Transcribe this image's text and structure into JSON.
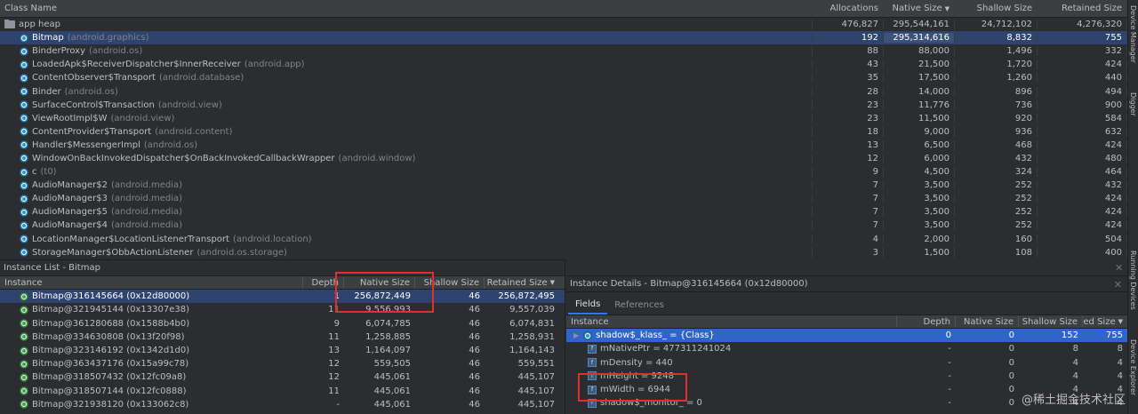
{
  "class_table": {
    "headers": {
      "name": "Class Name",
      "alloc": "Allocations",
      "native": "Native Size",
      "shallow": "Shallow Size",
      "retained": "Retained Size"
    },
    "sort_arrow": "▼",
    "heap_row": {
      "name": "app heap",
      "alloc": "476,827",
      "native": "295,544,161",
      "shallow": "24,712,102",
      "retained": "4,276,320"
    },
    "rows": [
      {
        "name": "Bitmap",
        "pkg": "(android.graphics)",
        "alloc": "192",
        "native": "295,314,616",
        "shallow": "8,832",
        "retained": "755"
      },
      {
        "name": "BinderProxy",
        "pkg": "(android.os)",
        "alloc": "88",
        "native": "88,000",
        "shallow": "1,496",
        "retained": "332"
      },
      {
        "name": "LoadedApk$ReceiverDispatcher$InnerReceiver",
        "pkg": "(android.app)",
        "alloc": "43",
        "native": "21,500",
        "shallow": "1,720",
        "retained": "424"
      },
      {
        "name": "ContentObserver$Transport",
        "pkg": "(android.database)",
        "alloc": "35",
        "native": "17,500",
        "shallow": "1,260",
        "retained": "440"
      },
      {
        "name": "Binder",
        "pkg": "(android.os)",
        "alloc": "28",
        "native": "14,000",
        "shallow": "896",
        "retained": "494"
      },
      {
        "name": "SurfaceControl$Transaction",
        "pkg": "(android.view)",
        "alloc": "23",
        "native": "11,776",
        "shallow": "736",
        "retained": "900"
      },
      {
        "name": "ViewRootImpl$W",
        "pkg": "(android.view)",
        "alloc": "23",
        "native": "11,500",
        "shallow": "920",
        "retained": "584"
      },
      {
        "name": "ContentProvider$Transport",
        "pkg": "(android.content)",
        "alloc": "18",
        "native": "9,000",
        "shallow": "936",
        "retained": "632"
      },
      {
        "name": "Handler$MessengerImpl",
        "pkg": "(android.os)",
        "alloc": "13",
        "native": "6,500",
        "shallow": "468",
        "retained": "424"
      },
      {
        "name": "WindowOnBackInvokedDispatcher$OnBackInvokedCallbackWrapper",
        "pkg": "(android.window)",
        "alloc": "12",
        "native": "6,000",
        "shallow": "432",
        "retained": "480"
      },
      {
        "name": "c",
        "pkg": "(t0)",
        "alloc": "9",
        "native": "4,500",
        "shallow": "324",
        "retained": "464"
      },
      {
        "name": "AudioManager$2",
        "pkg": "(android.media)",
        "alloc": "7",
        "native": "3,500",
        "shallow": "252",
        "retained": "432"
      },
      {
        "name": "AudioManager$3",
        "pkg": "(android.media)",
        "alloc": "7",
        "native": "3,500",
        "shallow": "252",
        "retained": "424"
      },
      {
        "name": "AudioManager$5",
        "pkg": "(android.media)",
        "alloc": "7",
        "native": "3,500",
        "shallow": "252",
        "retained": "424"
      },
      {
        "name": "AudioManager$4",
        "pkg": "(android.media)",
        "alloc": "7",
        "native": "3,500",
        "shallow": "252",
        "retained": "424"
      },
      {
        "name": "LocationManager$LocationListenerTransport",
        "pkg": "(android.location)",
        "alloc": "4",
        "native": "2,000",
        "shallow": "160",
        "retained": "504"
      },
      {
        "name": "StorageManager$ObbActionListener",
        "pkg": "(android.os.storage)",
        "alloc": "3",
        "native": "1,500",
        "shallow": "108",
        "retained": "400"
      }
    ]
  },
  "side_labels": [
    "Device Manager",
    "Digger",
    "Running Devices",
    "Device Explorer"
  ],
  "instance_list": {
    "title": "Instance List - Bitmap",
    "headers": {
      "inst": "Instance",
      "depth": "Depth",
      "native": "Native Size",
      "shallow": "Shallow Size",
      "retained": "Retained Size"
    },
    "rows": [
      {
        "name": "Bitmap@316145664 (0x12d80000)",
        "depth": "1",
        "native": "256,872,449",
        "shallow": "46",
        "retained": "256,872,495"
      },
      {
        "name": "Bitmap@321945144 (0x13307e38)",
        "depth": "11",
        "native": "9,556,993",
        "shallow": "46",
        "retained": "9,557,039"
      },
      {
        "name": "Bitmap@361280688 (0x1588b4b0)",
        "depth": "9",
        "native": "6,074,785",
        "shallow": "46",
        "retained": "6,074,831"
      },
      {
        "name": "Bitmap@334630808 (0x13f20f98)",
        "depth": "11",
        "native": "1,258,885",
        "shallow": "46",
        "retained": "1,258,931"
      },
      {
        "name": "Bitmap@323146192 (0x1342d1d0)",
        "depth": "13",
        "native": "1,164,097",
        "shallow": "46",
        "retained": "1,164,143"
      },
      {
        "name": "Bitmap@363437176 (0x15a99c78)",
        "depth": "12",
        "native": "559,505",
        "shallow": "46",
        "retained": "559,551"
      },
      {
        "name": "Bitmap@318507432 (0x12fc09a8)",
        "depth": "12",
        "native": "445,061",
        "shallow": "46",
        "retained": "445,107"
      },
      {
        "name": "Bitmap@318507144 (0x12fc0888)",
        "depth": "11",
        "native": "445,061",
        "shallow": "46",
        "retained": "445,107"
      },
      {
        "name": "Bitmap@321938120 (0x133062c8)",
        "depth": "-",
        "native": "445,061",
        "shallow": "46",
        "retained": "445,107"
      }
    ]
  },
  "instance_details": {
    "title": "Instance Details - Bitmap@316145664 (0x12d80000)",
    "tabs": [
      "Fields",
      "References"
    ],
    "headers": {
      "inst": "Instance",
      "depth": "Depth",
      "native": "Native Size",
      "shallow": "Shallow Size",
      "retained": "Retained Size"
    },
    "rows": [
      {
        "name": "shadow$_klass_ = {Class}",
        "depth": "0",
        "native": "0",
        "shallow": "152",
        "retained": "755"
      },
      {
        "name": "mNativePtr = 477311241024",
        "depth": "-",
        "native": "0",
        "shallow": "8",
        "retained": "8"
      },
      {
        "name": "mDensity = 440",
        "depth": "-",
        "native": "0",
        "shallow": "4",
        "retained": "4"
      },
      {
        "name": "mHeight = 9248",
        "depth": "-",
        "native": "0",
        "shallow": "4",
        "retained": "4"
      },
      {
        "name": "mWidth = 6944",
        "depth": "-",
        "native": "0",
        "shallow": "4",
        "retained": "4"
      },
      {
        "name": "shadow$_monitor_ = 0",
        "depth": "-",
        "native": "0",
        "shallow": "4",
        "retained": "4"
      }
    ]
  },
  "watermark": "@稀土掘金技术社区",
  "colors": {
    "selection": "#2e436e",
    "selection_strong": "#2f65ca",
    "annotation": "#e0302a"
  }
}
